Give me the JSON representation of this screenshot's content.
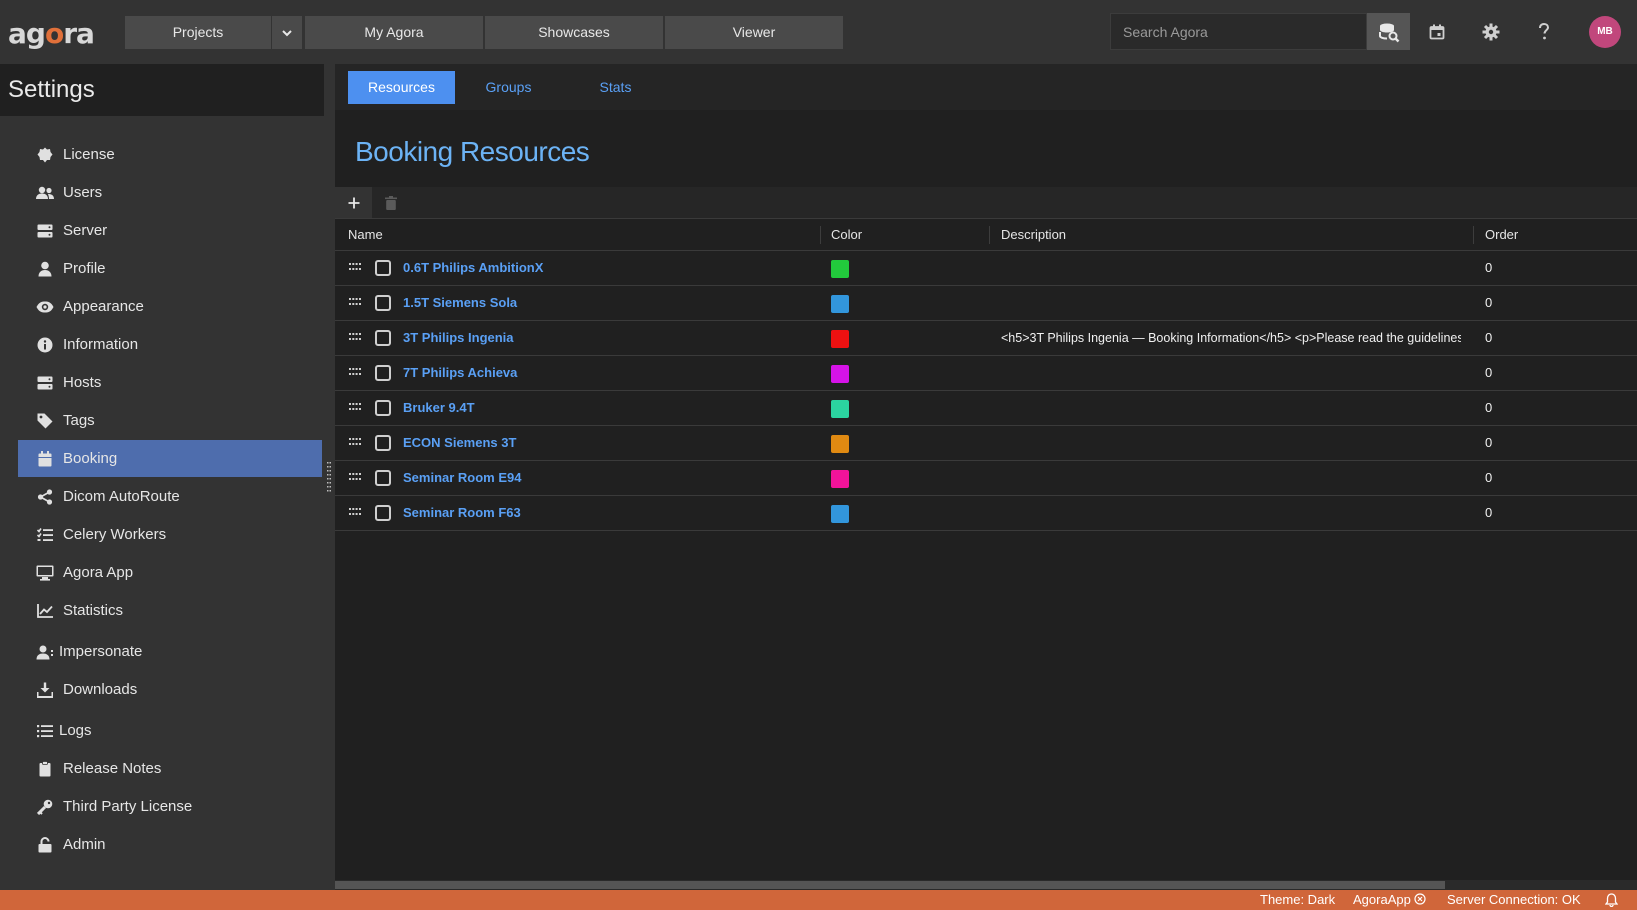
{
  "topbar": {
    "logo": "agora",
    "nav": {
      "projects": "Projects",
      "my_agora": "My Agora",
      "showcases": "Showcases",
      "viewer": "Viewer"
    },
    "search_placeholder": "Search Agora",
    "avatar_initials": "MB",
    "icons": [
      "database-search-icon",
      "calendar-icon",
      "gear-icon",
      "help-icon"
    ]
  },
  "sidebar": {
    "title": "Settings",
    "items": [
      {
        "label": "License",
        "icon": "badge-icon"
      },
      {
        "label": "Users",
        "icon": "users-icon"
      },
      {
        "label": "Server",
        "icon": "server-icon"
      },
      {
        "label": "Profile",
        "icon": "user-icon"
      },
      {
        "label": "Appearance",
        "icon": "eye-icon"
      },
      {
        "label": "Information",
        "icon": "info-icon"
      },
      {
        "label": "Hosts",
        "icon": "hosts-icon"
      },
      {
        "label": "Tags",
        "icon": "tag-icon"
      },
      {
        "label": "Booking",
        "icon": "calendar-icon",
        "active": true
      },
      {
        "label": "Dicom AutoRoute",
        "icon": "share-icon"
      },
      {
        "label": "Celery Workers",
        "icon": "tasks-icon"
      },
      {
        "label": "Agora App",
        "icon": "monitor-icon"
      },
      {
        "label": "Statistics",
        "icon": "chart-icon"
      },
      {
        "label": "Impersonate",
        "icon": "impersonate-icon"
      },
      {
        "label": "Downloads",
        "icon": "download-icon"
      },
      {
        "label": "Logs",
        "icon": "list-icon"
      },
      {
        "label": "Release Notes",
        "icon": "clipboard-icon"
      },
      {
        "label": "Third Party License",
        "icon": "key-icon"
      },
      {
        "label": "Admin",
        "icon": "lock-icon"
      }
    ]
  },
  "tabs": {
    "resources": "Resources",
    "groups": "Groups",
    "stats": "Stats"
  },
  "main": {
    "title": "Booking Resources"
  },
  "table": {
    "columns": {
      "name": "Name",
      "color": "Color",
      "description": "Description",
      "order": "Order"
    },
    "rows": [
      {
        "name": "0.6T Philips AmbitionX",
        "color": "#22c93c",
        "description": "",
        "order": "0"
      },
      {
        "name": "1.5T Siemens Sola",
        "color": "#3296dc",
        "description": "",
        "order": "0"
      },
      {
        "name": "3T Philips Ingenia",
        "color": "#ee1111",
        "description": "<h5>3T Philips Ingenia — Booking Information</h5> <p>Please read the guidelines...",
        "order": "0"
      },
      {
        "name": "7T Philips Achieva",
        "color": "#d613e8",
        "description": "",
        "order": "0"
      },
      {
        "name": "Bruker 9.4T",
        "color": "#2bd4a0",
        "description": "",
        "order": "0"
      },
      {
        "name": "ECON Siemens 3T",
        "color": "#e08a12",
        "description": "",
        "order": "0"
      },
      {
        "name": "Seminar Room E94",
        "color": "#f2139a",
        "description": "",
        "order": "0"
      },
      {
        "name": "Seminar Room F63",
        "color": "#3296dc",
        "description": "",
        "order": "0"
      }
    ]
  },
  "statusbar": {
    "theme": "Theme: Dark",
    "app": "AgoraApp",
    "connection": "Server Connection: OK"
  }
}
